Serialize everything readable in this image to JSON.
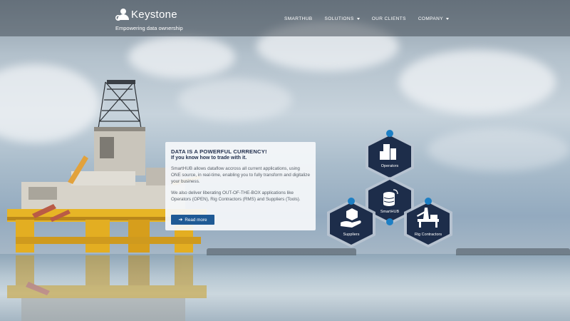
{
  "header": {
    "logo_text": "Keystone",
    "tagline": "Empowering data ownership",
    "nav": [
      {
        "label": "SMARTHUB",
        "has_dropdown": false
      },
      {
        "label": "SOLUTIONS",
        "has_dropdown": true
      },
      {
        "label": "OUR CLIENTS",
        "has_dropdown": false
      },
      {
        "label": "COMPANY",
        "has_dropdown": true
      }
    ]
  },
  "hero_card": {
    "headline": "DATA IS A POWERFUL CURRENCY!",
    "subheadline": "If you know how to trade with it.",
    "paragraph1": "SmartHUB allows dataflow accross all current applications, using ONE source, in real-time, enabling you to fully transform and digitalize your business.",
    "paragraph2": "We also deliver liberating OUT-OF-THE-BOX applications like Operators (OPEN), Rig Contractors (RMS) and Suppliers (Tools).",
    "button_label": "Read more"
  },
  "hex_diagram": {
    "nodes": [
      {
        "label": "Operators",
        "icon": "office-buildings-icon"
      },
      {
        "label": "SmartHUB",
        "icon": "database-signal-icon"
      },
      {
        "label": "Suppliers",
        "icon": "hand-box-icon"
      },
      {
        "label": "Rig Contractors",
        "icon": "drilling-rig-icon"
      }
    ]
  },
  "colors": {
    "hex_fill": "#1d2d4a",
    "hex_border": "#b9c4d2",
    "dot": "#1d7fc4",
    "button": "#1f5a95",
    "headline": "#1e2c4b"
  }
}
